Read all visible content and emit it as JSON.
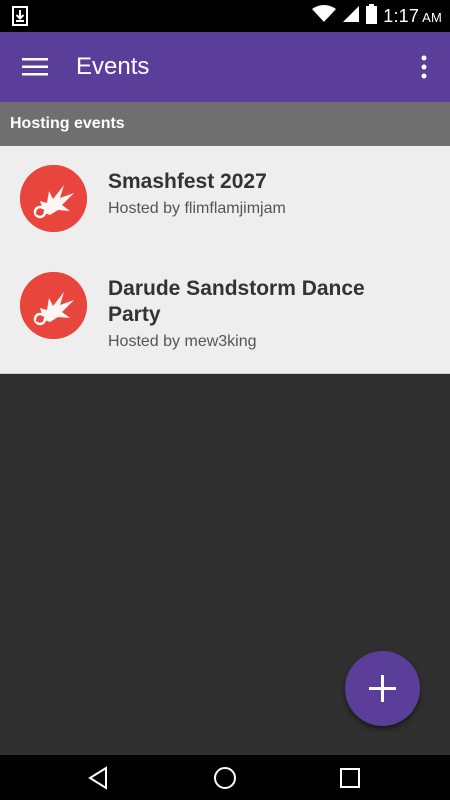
{
  "status_bar": {
    "time": "1:17",
    "ampm": "AM"
  },
  "app_bar": {
    "title": "Events"
  },
  "section": {
    "header": "Hosting events"
  },
  "events": [
    {
      "title": "Smashfest 2027",
      "host": "Hosted by flimflamjimjam"
    },
    {
      "title": "Darude Sandstorm Dance Party",
      "host": "Hosted by mew3king"
    }
  ],
  "colors": {
    "primary": "#5a3e99",
    "avatar": "#e8453c",
    "section_header": "#6f6f6f",
    "list_bg": "#eeeeee",
    "background": "#303030"
  },
  "icons": {
    "menu": "hamburger-menu-icon",
    "overflow": "more-vert-icon",
    "avatar": "explosion-icon",
    "fab": "plus-icon",
    "download": "download-icon"
  }
}
